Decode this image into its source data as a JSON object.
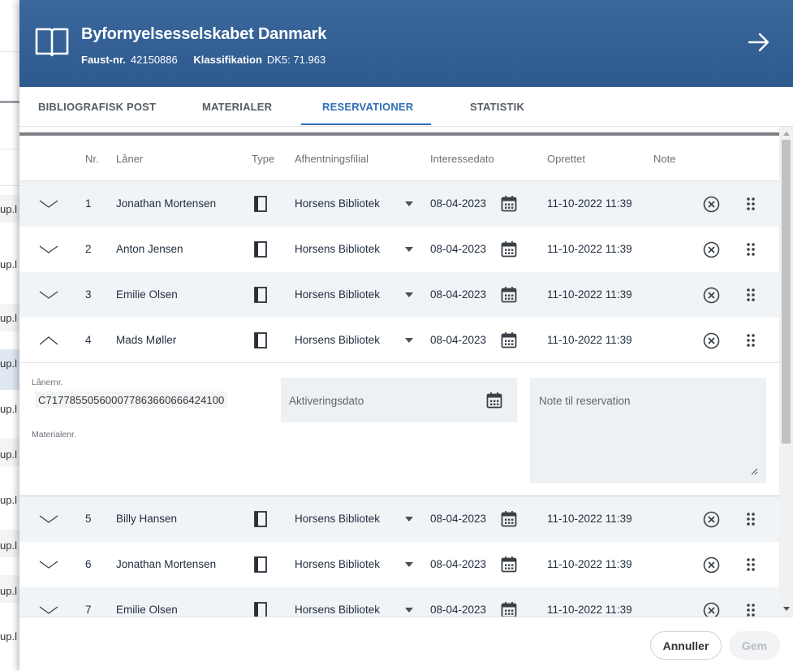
{
  "background": {
    "row_text": "up.l"
  },
  "header": {
    "title": "Byfornyelsesselskabet Danmark",
    "faust_label": "Faust-nr.",
    "faust_value": "42150886",
    "klass_label": "Klassifikation",
    "klass_value": "DK5: 71.963"
  },
  "tabs": [
    {
      "label": "BIBLIOGRAFISK POST"
    },
    {
      "label": "MATERIALER"
    },
    {
      "label": "RESERVATIONER"
    },
    {
      "label": "STATISTIK"
    }
  ],
  "table": {
    "headers": {
      "nr": "Nr.",
      "laaner": "Låner",
      "type": "Type",
      "filial": "Afhentningsfilial",
      "interesse": "Interessedato",
      "oprettet": "Oprettet",
      "note": "Note"
    },
    "rows": [
      {
        "nr": "1",
        "name": "Jonathan Mortensen",
        "filial": "Horsens Bibliotek",
        "interesse": "08-04-2023",
        "oprettet": "11-10-2022 11:39"
      },
      {
        "nr": "2",
        "name": "Anton Jensen",
        "filial": "Horsens Bibliotek",
        "interesse": "08-04-2023",
        "oprettet": "11-10-2022 11:39"
      },
      {
        "nr": "3",
        "name": "Emilie Olsen",
        "filial": "Horsens Bibliotek",
        "interesse": "08-04-2023",
        "oprettet": "11-10-2022 11:39"
      },
      {
        "nr": "4",
        "name": "Mads Møller",
        "filial": "Horsens Bibliotek",
        "interesse": "08-04-2023",
        "oprettet": "11-10-2022 11:39"
      },
      {
        "nr": "5",
        "name": "Billy Hansen",
        "filial": "Horsens Bibliotek",
        "interesse": "08-04-2023",
        "oprettet": "11-10-2022 11:39"
      },
      {
        "nr": "6",
        "name": "Jonathan Mortensen",
        "filial": "Horsens Bibliotek",
        "interesse": "08-04-2023",
        "oprettet": "11-10-2022 11:39"
      },
      {
        "nr": "7",
        "name": "Emilie Olsen",
        "filial": "Horsens Bibliotek",
        "interesse": "08-04-2023",
        "oprettet": "11-10-2022 11:39"
      }
    ]
  },
  "detail": {
    "laanernr_label": "Lånernr.",
    "laanernr_value": "C71778550560007786366066642410​0",
    "materialenr_label": "Materialenr.",
    "aktivering_placeholder": "Aktiveringsdato",
    "note_placeholder": "Note til reservation"
  },
  "footer": {
    "cancel_label": "Annuller",
    "save_label": "Gem"
  },
  "colors": {
    "header_bg": "#2d5a8f",
    "accent": "#2f6db5"
  }
}
